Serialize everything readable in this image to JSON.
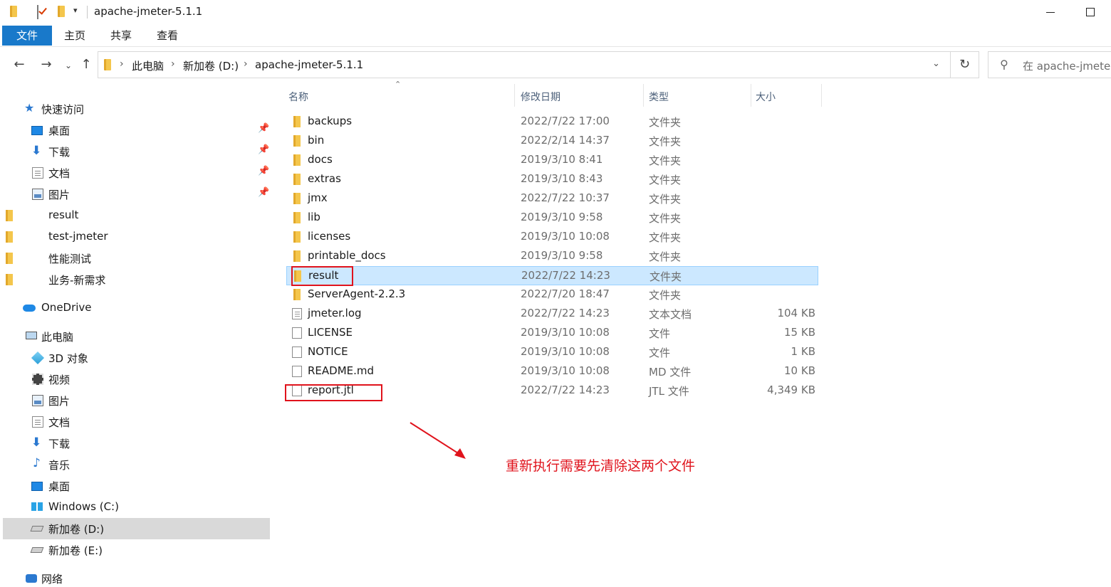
{
  "window": {
    "title": "apache-jmeter-5.1.1",
    "qa_dropdown": "▾"
  },
  "ribbon": {
    "tabs": [
      "文件",
      "主页",
      "共享",
      "查看"
    ]
  },
  "address": {
    "crumbs": [
      "此电脑",
      "新加卷 (D:)",
      "apache-jmeter-5.1.1"
    ]
  },
  "search": {
    "placeholder": "在 apache-jmeter"
  },
  "navpane": {
    "quick_access": "快速访问",
    "quick_items": [
      "桌面",
      "下载",
      "文档",
      "图片",
      "result",
      "test-jmeter",
      "性能测试",
      "业务-新需求"
    ],
    "onedrive": "OneDrive",
    "this_pc": "此电脑",
    "pc_items": [
      "3D 对象",
      "视频",
      "图片",
      "文档",
      "下载",
      "音乐",
      "桌面",
      "Windows (C:)",
      "新加卷 (D:)",
      "新加卷 (E:)"
    ],
    "network": "网络",
    "selected": "新加卷 (D:)"
  },
  "columns": {
    "name": "名称",
    "date": "修改日期",
    "type": "类型",
    "size": "大小"
  },
  "files": [
    {
      "name": "backups",
      "date": "2022/7/22 17:00",
      "type": "文件夹",
      "size": "",
      "kind": "folder"
    },
    {
      "name": "bin",
      "date": "2022/2/14 14:37",
      "type": "文件夹",
      "size": "",
      "kind": "folder"
    },
    {
      "name": "docs",
      "date": "2019/3/10 8:41",
      "type": "文件夹",
      "size": "",
      "kind": "folder"
    },
    {
      "name": "extras",
      "date": "2019/3/10 8:43",
      "type": "文件夹",
      "size": "",
      "kind": "folder"
    },
    {
      "name": "jmx",
      "date": "2022/7/22 10:37",
      "type": "文件夹",
      "size": "",
      "kind": "folder"
    },
    {
      "name": "lib",
      "date": "2019/3/10 9:58",
      "type": "文件夹",
      "size": "",
      "kind": "folder"
    },
    {
      "name": "licenses",
      "date": "2019/3/10 10:08",
      "type": "文件夹",
      "size": "",
      "kind": "folder"
    },
    {
      "name": "printable_docs",
      "date": "2019/3/10 9:58",
      "type": "文件夹",
      "size": "",
      "kind": "folder"
    },
    {
      "name": "result",
      "date": "2022/7/22 14:23",
      "type": "文件夹",
      "size": "",
      "kind": "folder"
    },
    {
      "name": "ServerAgent-2.2.3",
      "date": "2022/7/20 18:47",
      "type": "文件夹",
      "size": "",
      "kind": "folder"
    },
    {
      "name": "jmeter.log",
      "date": "2022/7/22 14:23",
      "type": "文本文档",
      "size": "104 KB",
      "kind": "text"
    },
    {
      "name": "LICENSE",
      "date": "2019/3/10 10:08",
      "type": "文件",
      "size": "15 KB",
      "kind": "file"
    },
    {
      "name": "NOTICE",
      "date": "2019/3/10 10:08",
      "type": "文件",
      "size": "1 KB",
      "kind": "file"
    },
    {
      "name": "README.md",
      "date": "2019/3/10 10:08",
      "type": "MD 文件",
      "size": "10 KB",
      "kind": "file"
    },
    {
      "name": "report.jtl",
      "date": "2022/7/22 14:23",
      "type": "JTL 文件",
      "size": "4,349 KB",
      "kind": "file"
    }
  ],
  "selected_file": "result",
  "annotation": {
    "text": "重新执行需要先清除这两个文件",
    "color": "#e0131c"
  },
  "colors": {
    "file_tab": "#1979ca",
    "selection": "#cce8ff",
    "nav_selected": "#d9d9d9",
    "annotation_red": "#e0131c"
  }
}
